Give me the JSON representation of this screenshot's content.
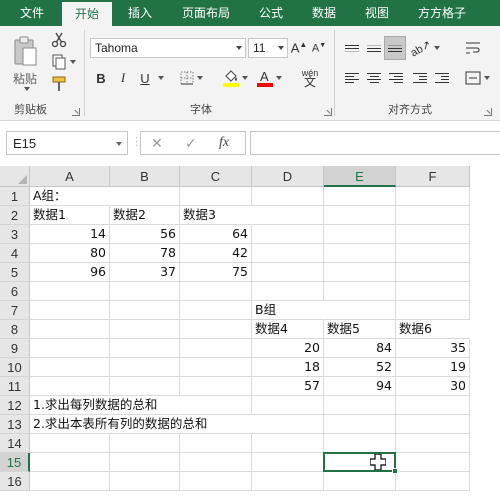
{
  "ribbon_tabs": [
    "文件",
    "开始",
    "插入",
    "页面布局",
    "公式",
    "数据",
    "视图",
    "方方格子"
  ],
  "active_tab": "开始",
  "clipboard": {
    "paste_label": "粘贴",
    "group_label": "剪贴板"
  },
  "font": {
    "name": "Tahoma",
    "size": "11",
    "bold": "B",
    "italic": "I",
    "underline": "U",
    "phonetic": "wén",
    "group_label": "字体",
    "fill_color": "#ffff00",
    "font_color": "#ff0000"
  },
  "alignment": {
    "group_label": "对齐方式"
  },
  "formula_bar": {
    "name_box": "E15",
    "cancel": "✕",
    "enter": "✓",
    "fx": "fx",
    "value": ""
  },
  "columns": [
    "A",
    "B",
    "C",
    "D",
    "E",
    "F"
  ],
  "rows": [
    "1",
    "2",
    "3",
    "4",
    "5",
    "6",
    "7",
    "8",
    "9",
    "10",
    "11",
    "12",
    "13",
    "14",
    "15",
    "16"
  ],
  "selected_cell": "E15",
  "cells": {
    "A1": "A组：",
    "A2": "数据1",
    "B2": "数据2",
    "C2": "数据3",
    "A3": "14",
    "B3": "56",
    "C3": "64",
    "A4": "80",
    "B4": "78",
    "C4": "42",
    "A5": "96",
    "B5": "37",
    "C5": "75",
    "D7": "B组",
    "D8": "数据4",
    "E8": "数据5",
    "F8": "数据6",
    "D9": "20",
    "E9": "84",
    "F9": "35",
    "D10": "18",
    "E10": "52",
    "F10": "19",
    "D11": "57",
    "E11": "94",
    "F11": "30",
    "A12": "1.求出每列数据的总和",
    "A13": "2.求出本表所有列的数据的总和"
  },
  "colors": {
    "accent": "#217346"
  }
}
